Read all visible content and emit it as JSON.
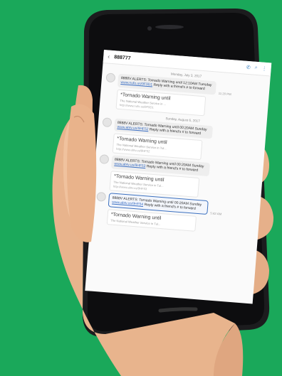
{
  "conversation": {
    "number": "888777",
    "back_icon": "back-arrow-icon",
    "actions": [
      "phone-icon",
      "search-icon",
      "more-icon"
    ]
  },
  "sections": [
    {
      "date": "Monday, July 3, 2017",
      "messages": [
        {
          "prefix": "8888V ALERTS: Tornado Warning until 12:10AM Tuesday ",
          "link": "www.nufo.us/9F9D1",
          "suffix": " Reply with a friend's # to forward",
          "time": "11:20 PM",
          "preview_title": "*Tornado Warning until",
          "preview_sub": "The National Weather Service in ...",
          "preview_url": "http://www.nufo.us/9F9D1"
        }
      ]
    },
    {
      "date": "Sunday, August 6, 2017",
      "messages": [
        {
          "prefix": "8888V ALERTS: Tornado Warning until 00:20AM Sunday ",
          "link": "www.abtv.us/9HF52",
          "suffix": " Reply with a friend's # to forward",
          "time": "",
          "preview_title": "*Tornado Warning until",
          "preview_sub": "The National Weather Service in Tul...",
          "preview_url": "http://www.abtv.us/9HF52"
        },
        {
          "prefix": "8888V ALERTS: Tornado Warning until 00:20AM Sunday ",
          "link": "www.abtv.us/9HF53",
          "suffix": " Reply with a friend's # to forward",
          "time": "",
          "preview_title": "*Tornado Warning until",
          "preview_sub": "The National Weather Service in Tul...",
          "preview_url": "http://www.abtv.us/9HF53"
        },
        {
          "prefix": "8888V ALERTS: Tornado Warning until 00:20AM Sunday ",
          "link": "www.abtv.us/9HF54",
          "suffix": " Reply with a friend's # to forward",
          "time": "5:42 AM",
          "selected": true,
          "preview_title": "*Tornado Warning until",
          "preview_sub": "The National Weather Service in Tul...",
          "preview_url": ""
        }
      ]
    }
  ],
  "colors": {
    "background": "#1aa85a",
    "accent": "#3b6fc4"
  }
}
